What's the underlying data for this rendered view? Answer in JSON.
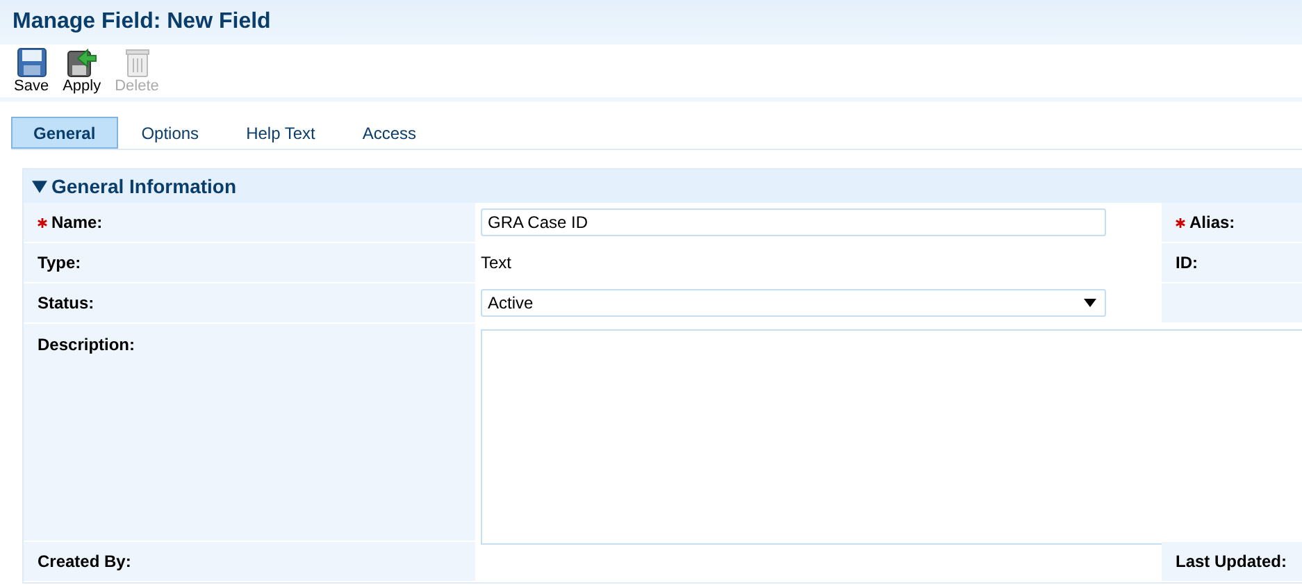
{
  "title": "Manage Field: New Field",
  "toolbar": [
    {
      "label": "Save",
      "disabled": false
    },
    {
      "label": "Apply",
      "disabled": false
    },
    {
      "label": "Delete",
      "disabled": true
    }
  ],
  "tabs": [
    {
      "label": "General",
      "selected": true
    },
    {
      "label": "Options",
      "selected": false
    },
    {
      "label": "Help Text",
      "selected": false
    },
    {
      "label": "Access",
      "selected": false
    }
  ],
  "section": {
    "title": "General Information",
    "expanded": true,
    "rows": [
      {
        "label": "Name:",
        "required": true,
        "kind": "input",
        "value": "GRA Case ID",
        "side_label": "Alias:",
        "side_required": true
      },
      {
        "label": "Type:",
        "required": false,
        "kind": "text",
        "value": "Text",
        "side_label": "ID:",
        "side_required": false
      },
      {
        "label": "Status:",
        "required": false,
        "kind": "select",
        "value": "Active"
      },
      {
        "label": "Description:",
        "required": false,
        "kind": "textarea"
      },
      {
        "label": "Created By:",
        "required": false,
        "kind": "text",
        "side_label": "Last Updated:",
        "side_required": false
      }
    ]
  }
}
